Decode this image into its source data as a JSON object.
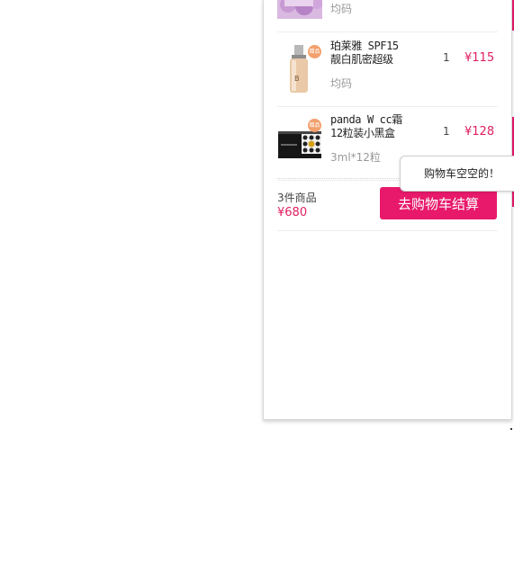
{
  "cart": {
    "items": [
      {
        "name_line1": "",
        "name_line2": "",
        "spec": "均码",
        "quantity": "",
        "price": "",
        "image": "lavender-product-image"
      },
      {
        "name_line1": "珀莱雅 SPF15",
        "name_line2": "靓白肌密超级",
        "spec": "均码",
        "quantity": "1",
        "price": "¥115",
        "gift_badge": "赠品",
        "image": "foundation-bottle-image"
      },
      {
        "name_line1": "panda W cc霜",
        "name_line2": "12粒装小黑盒",
        "spec": "3ml*12粒",
        "quantity": "1",
        "price": "¥128",
        "gift_badge": "赠品",
        "image": "black-box-capsules-image"
      }
    ],
    "summary": {
      "count": "3件商品",
      "total": "¥680"
    },
    "checkout_label": "去购物车结算",
    "empty_tip": "购物车空空的！"
  },
  "colors": {
    "accent": "#e8196b",
    "price": "#e0205f",
    "badge": "#f2a06d"
  }
}
